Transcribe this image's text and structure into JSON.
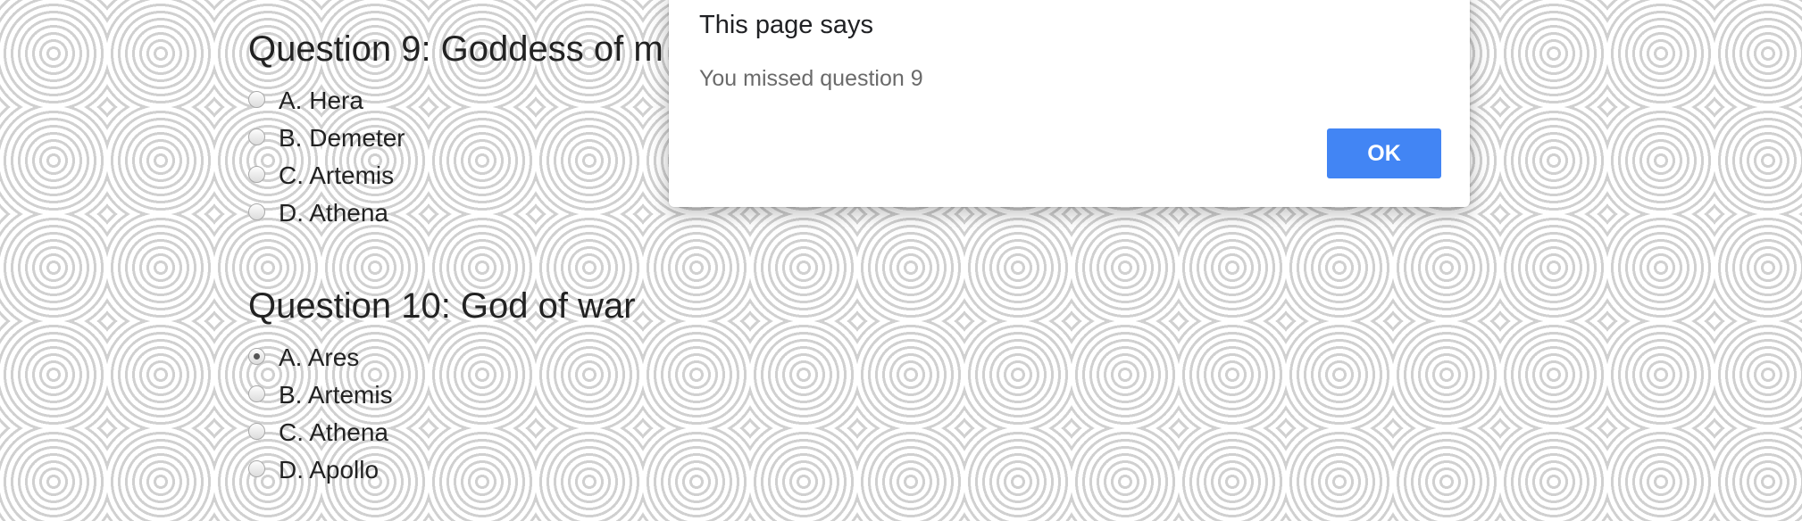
{
  "questions": [
    {
      "title": "Question 9: Goddess of m",
      "options": [
        {
          "label": "A. Hera",
          "checked": false
        },
        {
          "label": "B. Demeter",
          "checked": false
        },
        {
          "label": "C. Artemis",
          "checked": false
        },
        {
          "label": "D. Athena",
          "checked": false
        }
      ]
    },
    {
      "title": "Question 10: God of war",
      "options": [
        {
          "label": "A. Ares",
          "checked": true
        },
        {
          "label": "B. Artemis",
          "checked": false
        },
        {
          "label": "C. Athena",
          "checked": false
        },
        {
          "label": "D. Apollo",
          "checked": false
        }
      ]
    }
  ],
  "dialog": {
    "title": "This page says",
    "message": "You missed question 9",
    "ok_label": "OK",
    "button_color": "#4285f4"
  },
  "background": {
    "pattern": "concentric-circles",
    "color": "#d0d0d0"
  }
}
